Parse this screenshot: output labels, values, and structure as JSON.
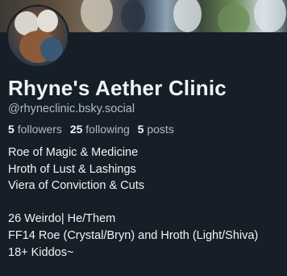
{
  "profile": {
    "display_name": "Rhyne's Aether Clinic",
    "handle": "@rhyneclinic.bsky.social",
    "stats": {
      "followers_count": "5",
      "followers_label": "followers",
      "following_count": "25",
      "following_label": "following",
      "posts_count": "5",
      "posts_label": "posts"
    },
    "bio": [
      "Roe of Magic & Medicine",
      "Hroth of Lust & Lashings",
      "Viera of Conviction & Cuts",
      "",
      "26 Weirdo| He/Them",
      "FF14 Roe (Crystal/Bryn) and Hroth (Light/Shiva)",
      "18+ Kiddos~"
    ]
  },
  "colors": {
    "background": "#161e27",
    "text_primary": "#f1f3f5",
    "text_secondary": "#aebbc9"
  }
}
